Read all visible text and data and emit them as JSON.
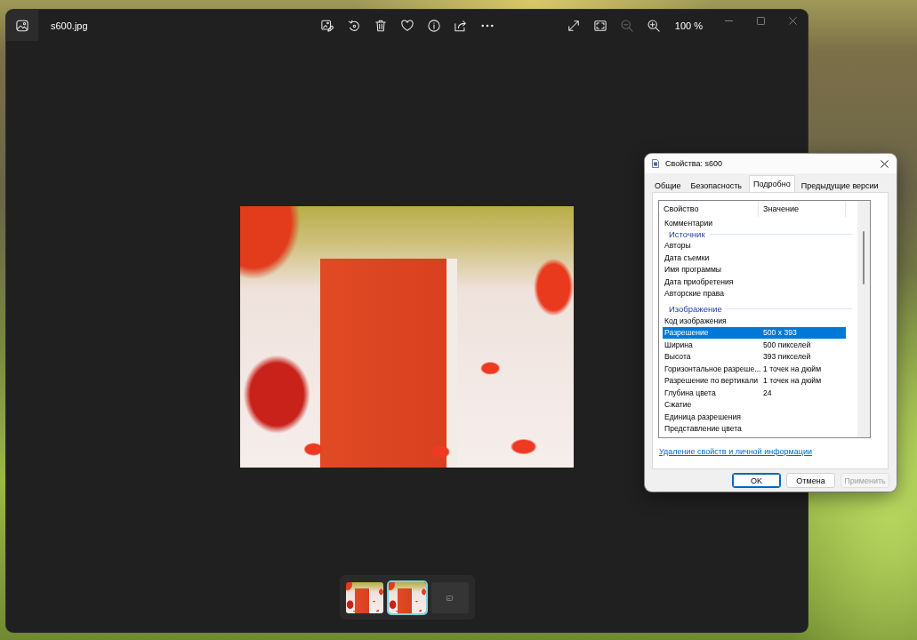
{
  "photo_viewer": {
    "file_name": "s600.jpg",
    "zoom_out": {
      "disabled": true
    },
    "zoom_in": {
      "disabled": false
    },
    "zoom_reading": "100 %",
    "filmstrip": [
      {
        "kind": "photo",
        "selected": false
      },
      {
        "kind": "photo",
        "selected": true
      },
      {
        "kind": "empty",
        "selected": false
      }
    ]
  },
  "properties_dialog": {
    "title": "Свойства: s600",
    "tabs": [
      {
        "label": "Общие",
        "selected": false
      },
      {
        "label": "Безопасность",
        "selected": false
      },
      {
        "label": "Подробно",
        "selected": true
      },
      {
        "label": "Предыдущие версии",
        "selected": false
      }
    ],
    "columns": [
      "Свойство",
      "Значение"
    ],
    "partial_row": "Комментарии",
    "groups": [
      {
        "title": "Источник",
        "rows": [
          {
            "name": "Авторы",
            "selected": false
          },
          {
            "name": "Дата съемки",
            "selected": false
          },
          {
            "name": "Имя программы",
            "selected": false
          },
          {
            "name": "Дата приобретения",
            "selected": false
          },
          {
            "name": "Авторские права",
            "selected": false
          }
        ]
      },
      {
        "title": "Изображение",
        "rows": [
          {
            "name": "Код изображения",
            "selected": false
          },
          {
            "name": "Разрешение",
            "value": "500 x 393",
            "selected": true
          },
          {
            "name": "Ширина",
            "value": "500 пикселей",
            "selected": false
          },
          {
            "name": "Высота",
            "value": "393 пикселей",
            "selected": false
          },
          {
            "name": "Горизонтальное разреше...",
            "value": "1 точек на дюйм",
            "selected": false
          },
          {
            "name": "Разрешение по вертикали",
            "value": "1 точек на дюйм",
            "selected": false
          },
          {
            "name": "Глубина цвета",
            "value": "24",
            "selected": false
          },
          {
            "name": "Сжатие",
            "selected": false
          },
          {
            "name": "Единица разрешения",
            "selected": false
          },
          {
            "name": "Представление цвета",
            "selected": false
          }
        ]
      }
    ],
    "link": "Удаление свойств и личной информации",
    "buttons": [
      {
        "label": "OK",
        "default": true,
        "disabled": false
      },
      {
        "label": "Отмена",
        "default": false,
        "disabled": false
      },
      {
        "label": "Применить",
        "default": false,
        "disabled": true
      }
    ]
  }
}
